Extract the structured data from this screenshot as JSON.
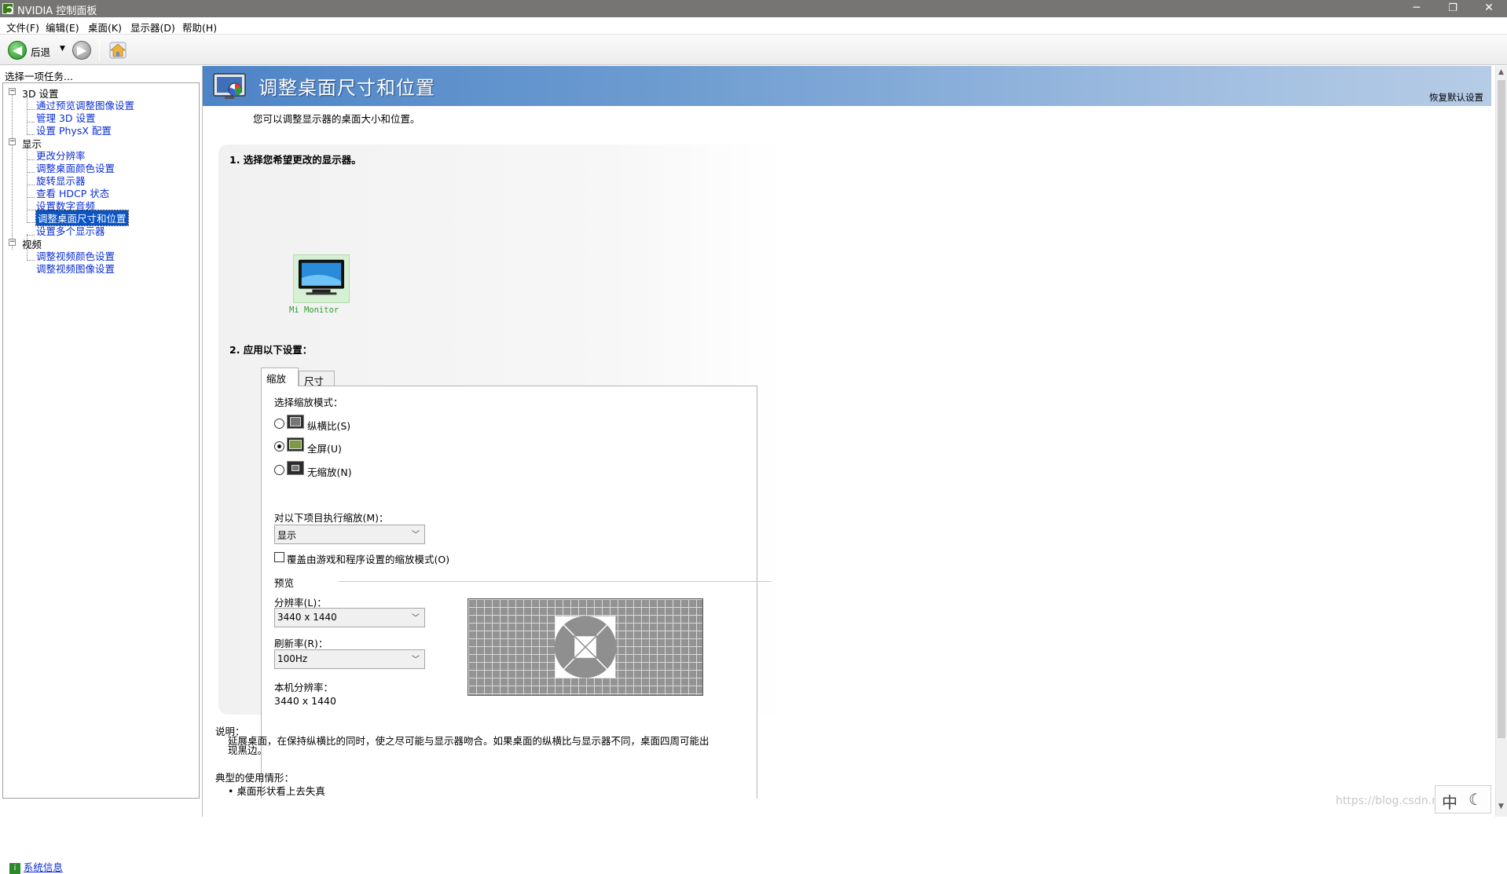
{
  "window": {
    "title": "NVIDIA 控制面板",
    "minimize": "─",
    "restore": "❐",
    "close": "✕"
  },
  "menu": [
    "文件(F)",
    "编辑(E)",
    "桌面(K)",
    "显示器(D)",
    "帮助(H)"
  ],
  "toolbar": {
    "back_label": "后退",
    "back_glyph": "◀",
    "forward_glyph": "▶",
    "dropdown_glyph": "▼"
  },
  "left": {
    "task_title": "选择一项任务...",
    "tree": {
      "cat_3d": "3D 设置",
      "cat_3d_items": [
        "通过预览调整图像设置",
        "管理 3D 设置",
        "设置 PhysX 配置"
      ],
      "cat_display": "显示",
      "cat_display_items": [
        "更改分辨率",
        "调整桌面颜色设置",
        "旋转显示器",
        "查看 HDCP 状态",
        "设置数字音频",
        "调整桌面尺寸和位置",
        "设置多个显示器"
      ],
      "cat_video": "视频",
      "cat_video_items": [
        "调整视频颜色设置",
        "调整视频图像设置"
      ],
      "toggle": "−"
    },
    "sysinfo": "系统信息"
  },
  "page": {
    "title": "调整桌面尺寸和位置",
    "restore_defaults": "恢复默认设置",
    "subtitle": "您可以调整显示器的桌面大小和位置。",
    "step1": "1.  选择您希望更改的显示器。",
    "monitor_name": "Mi Monitor",
    "step2": "2.  应用以下设置：",
    "tabs": [
      "缩放",
      "尺寸"
    ],
    "scaling_mode_label": "选择缩放模式：",
    "modes": [
      "纵横比(S)",
      "全屏(U)",
      "无缩放(N)"
    ],
    "selected_mode": "全屏(U)",
    "perform_on_label": "对以下项目执行缩放(M)：",
    "perform_on_value": "显示",
    "override_label": "覆盖由游戏和程序设置的缩放模式(O)",
    "override_checked": false,
    "preview_label": "预览",
    "resolution_label": "分辨率(L)：",
    "resolution_value": "3440 x 1440",
    "refresh_label": "刷新率(R)：",
    "refresh_value": "100Hz",
    "native_res_label": "本机分辨率：",
    "native_res_value": "3440 x 1440",
    "desc_label": "说明：",
    "desc_text": "延展桌面，在保持纵横比的同时，使之尽可能与显示器吻合。如果桌面的纵横比与显示器不同，桌面四周可能出现黑边。",
    "usage_label": "典型的使用情形：",
    "usage_item": "•  桌面形状看上去失真"
  },
  "ime": {
    "lang": "中",
    "mode": "☾"
  },
  "watermark": "https://blog.csdn.net/qq_",
  "colors": {
    "title_bar": "#777474",
    "banner": "#4d84c7",
    "link": "#0a2ed1",
    "selected": "#0a54c6",
    "nvidia_green": "#76b900"
  }
}
